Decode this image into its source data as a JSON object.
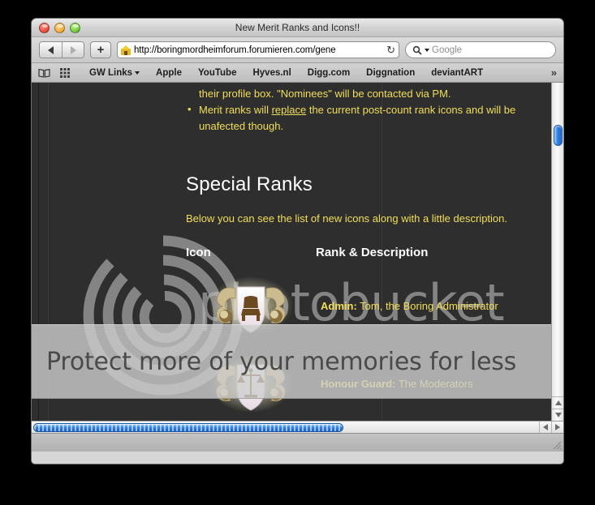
{
  "window": {
    "title": "New Merit Ranks and Icons!!",
    "controls": {
      "close": "close",
      "minimize": "minimize",
      "zoom": "zoom"
    }
  },
  "toolbar": {
    "back_icon": "back-arrow-icon",
    "forward_icon": "forward-arrow-icon",
    "add_label": "+",
    "url": "http://boringmordheimforum.forumieren.com/gene",
    "reload_icon": "↻",
    "search_placeholder": "Google",
    "search_icon": "search-magnifier-icon"
  },
  "bookmarks": {
    "book_icon": "open-book-icon",
    "grid_icon": "grid-apps-icon",
    "items": [
      {
        "label": "GW Links",
        "has_menu": true
      },
      {
        "label": "Apple",
        "has_menu": false
      },
      {
        "label": "YouTube",
        "has_menu": false
      },
      {
        "label": "Hyves.nl",
        "has_menu": false
      },
      {
        "label": "Digg.com",
        "has_menu": false
      },
      {
        "label": "Diggnation",
        "has_menu": false
      },
      {
        "label": "deviantART",
        "has_menu": false
      }
    ],
    "overflow": "»"
  },
  "page": {
    "notes": [
      {
        "bulleted": false,
        "text": "their profile box. \"Nominees\" will be contacted via PM."
      },
      {
        "bulleted": true,
        "pre": "Merit ranks will ",
        "underlined": "replace",
        "post": " the current post-count rank icons and will be unafected though."
      }
    ],
    "section_title": "Special Ranks",
    "section_desc": "Below you can see the list of new icons along with a little description.",
    "table": {
      "headers": {
        "icon": "Icon",
        "rank": "Rank & Description"
      },
      "rows": [
        {
          "icon_name": "admin-crest-icon",
          "rank": "Admin:",
          "description": " Tom, the Boring Administrator"
        },
        {
          "icon_name": "honour-guard-scales-crest-icon",
          "rank": "Honour Guard:",
          "description": " The Moderators"
        }
      ]
    },
    "watermark": {
      "wordmark": "photobucket",
      "ring_icon": "photobucket-ring-logo-icon"
    },
    "promo_banner": {
      "text": "Protect more of your memories for less"
    }
  },
  "colors": {
    "page_bg": "#2e2e2e",
    "body_text": "#f2de58",
    "heading_text": "#ffffff",
    "scroll_thumb": "#2f7fe0",
    "watermark": "#b9b9b9",
    "banner_bg": "#cdcdcd"
  }
}
